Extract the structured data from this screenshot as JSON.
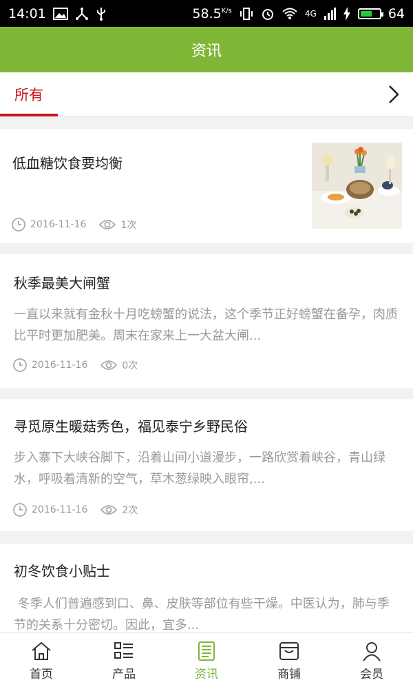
{
  "status_bar": {
    "time": "14:01",
    "speed": "58.5",
    "speed_unit": "K/s",
    "network": "4G",
    "battery": "64"
  },
  "header": {
    "title": "资讯"
  },
  "tabs": {
    "active_label": "所有"
  },
  "articles": [
    {
      "title": "低血糖饮食要均衡",
      "summary": "",
      "date": "2016-11-16",
      "views": "1次",
      "has_image": true
    },
    {
      "title": "秋季最美大闸蟹",
      "summary": "一直以来就有金秋十月吃螃蟹的说法，这个季节正好螃蟹在备孕，肉质比平时更加肥美。周末在家来上一大盆大闸...",
      "date": "2016-11-16",
      "views": "0次"
    },
    {
      "title": "寻觅原生暖菇秀色，福见泰宁乡野民俗",
      "summary": "步入寨下大峡谷脚下，沿着山间小道漫步，一路欣赏着峡谷，青山绿水，呼吸着清新的空气，草木葱绿映入眼帘,...",
      "date": "2016-11-16",
      "views": "2次"
    },
    {
      "title": "初冬饮食小贴士",
      "summary": " 冬季人们普遍感到口、鼻、皮肤等部位有些干燥。中医认为，肺与季节的关系十分密切。因此，宜多...",
      "date": "",
      "views": ""
    }
  ],
  "bottom_nav": [
    {
      "label": "首页",
      "icon": "home-icon"
    },
    {
      "label": "产品",
      "icon": "list-icon"
    },
    {
      "label": "资讯",
      "icon": "news-icon",
      "active": true
    },
    {
      "label": "商铺",
      "icon": "shop-icon"
    },
    {
      "label": "会员",
      "icon": "user-icon"
    }
  ],
  "colors": {
    "accent": "#80b636",
    "tab_active": "#c8161d"
  }
}
